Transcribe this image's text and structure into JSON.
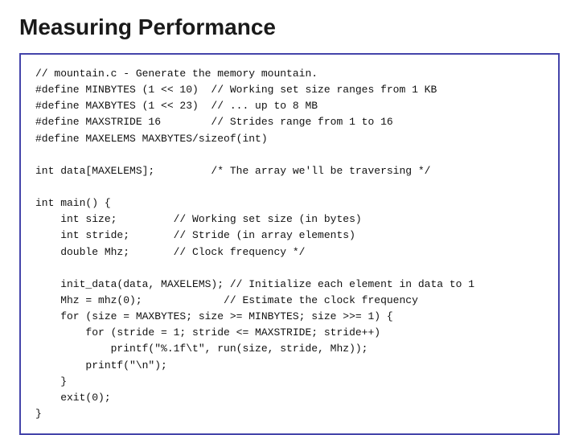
{
  "page": {
    "title": "Measuring Performance",
    "code": "// mountain.c - Generate the memory mountain.\n#define MINBYTES (1 << 10)  // Working set size ranges from 1 KB\n#define MAXBYTES (1 << 23)  // ... up to 8 MB\n#define MAXSTRIDE 16        // Strides range from 1 to 16\n#define MAXELEMS MAXBYTES/sizeof(int)\n\nint data[MAXELEMS];         /* The array we'll be traversing */\n\nint main() {\n    int size;         // Working set size (in bytes)\n    int stride;       // Stride (in array elements)\n    double Mhz;       // Clock frequency */\n\n    init_data(data, MAXELEMS); // Initialize each element in data to 1\n    Mhz = mhz(0);             // Estimate the clock frequency\n    for (size = MAXBYTES; size >= MINBYTES; size >>= 1) {\n        for (stride = 1; stride <= MAXSTRIDE; stride++)\n            printf(\"%.1f\\t\", run(size, stride, Mhz));\n        printf(\"\\n\");\n    }\n    exit(0);\n}"
  }
}
